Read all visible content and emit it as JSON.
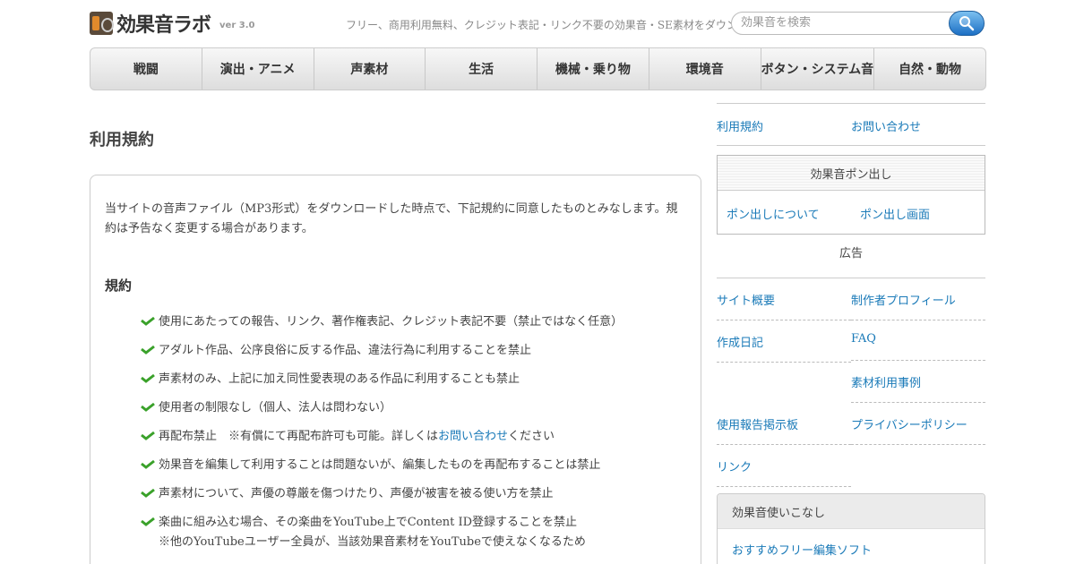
{
  "header": {
    "logo_text": "効果音ラボ",
    "version": "ver 3.0",
    "tagline": "フリー、商用利用無料、クレジット表記・リンク不要の効果音・SE素材をダウンロード",
    "search_placeholder": "効果音を検索"
  },
  "nav": {
    "items": [
      {
        "label": "戦闘"
      },
      {
        "label": "演出・アニメ"
      },
      {
        "label": "声素材"
      },
      {
        "label": "生活"
      },
      {
        "label": "機械・乗り物"
      },
      {
        "label": "環境音"
      },
      {
        "label": "ボタン・システム音"
      },
      {
        "label": "自然・動物"
      }
    ]
  },
  "main": {
    "title": "利用規約",
    "intro": "当サイトの音声ファイル（MP3形式）をダウンロードした時点で、下記規約に同意したものとみなします。規約は予告なく変更する場合があります。",
    "section_title": "規約",
    "rules": [
      "使用にあたっての報告、リンク、著作権表記、クレジット表記不要（禁止ではなく任意）",
      "アダルト作品、公序良俗に反する作品、違法行為に利用することを禁止",
      "声素材のみ、上記に加え同性愛表現のある作品に利用することも禁止",
      "使用者の制限なし（個人、法人は問わない）",
      {
        "before": "再配布禁止　※有償にて再配布許可も可能。詳しくは",
        "link": "お問い合わせ",
        "after": "ください"
      },
      "効果音を編集して利用することは問題ないが、編集したものを再配布することは禁止",
      "声素材について、声優の尊厳を傷つけたり、声優が被害を被る使い方を禁止",
      {
        "line1": "楽曲に組み込む場合、その楽曲をYouTube上でContent ID登録することを禁止",
        "line2": "※他のYouTubeユーザー全員が、当該効果音素材をYouTubeで使えなくなるため"
      }
    ]
  },
  "sidebar": {
    "top_links": [
      "利用規約",
      "お問い合わせ"
    ],
    "pon": {
      "title": "効果音ポン出し",
      "links": [
        "ポン出しについて",
        "ポン出し画面"
      ]
    },
    "ad_label": "広告",
    "links": [
      "サイト概要",
      "制作者プロフィール",
      "作成日記",
      "FAQ",
      "素材利用事例",
      "使用報告掲示板",
      "プライバシーポリシー",
      "リンク"
    ],
    "tips": {
      "title": "効果音使いこなし",
      "link": "おすすめフリー編集ソフト"
    }
  },
  "colors": {
    "link": "#1a7ab8",
    "check": "#3aa12a"
  },
  "icons": {
    "search": "magnifier-icon",
    "rule_bullet": "check-icon",
    "logo": "speaker-icon"
  }
}
